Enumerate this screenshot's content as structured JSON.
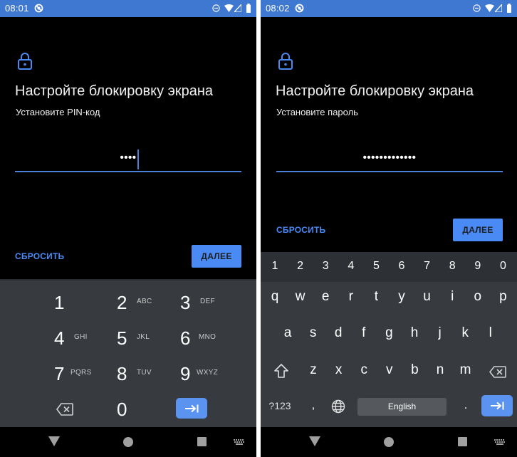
{
  "colors": {
    "statusbar": "#3f78d0",
    "accent": "#4a8af4",
    "keyboard_bg": "#373b3f",
    "numrow_bg": "#2d3135",
    "screen_bg": "#000000"
  },
  "screens": [
    {
      "status": {
        "time": "08:01",
        "icons": [
          "sync-off-icon",
          "do-not-disturb-icon",
          "wifi-icon",
          "cell-signal-icon",
          "battery-icon"
        ]
      },
      "icon": "lock-icon",
      "title": "Настройте блокировку экрана",
      "subtitle": "Установите PIN-код",
      "input": {
        "masked_value": "••••",
        "length": 4,
        "focused": true
      },
      "reset_label": "СБРОСИТЬ",
      "next_label": "ДАЛЕЕ",
      "keypad": {
        "keys": [
          {
            "digit": "1",
            "letters": ""
          },
          {
            "digit": "2",
            "letters": "ABC"
          },
          {
            "digit": "3",
            "letters": "DEF"
          },
          {
            "digit": "4",
            "letters": "GHI"
          },
          {
            "digit": "5",
            "letters": "JKL"
          },
          {
            "digit": "6",
            "letters": "MNO"
          },
          {
            "digit": "7",
            "letters": "PQRS"
          },
          {
            "digit": "8",
            "letters": "TUV"
          },
          {
            "digit": "9",
            "letters": "WXYZ"
          },
          {
            "digit": "0",
            "letters": ""
          }
        ],
        "backspace_icon": "backspace-icon",
        "enter_icon": "tab-next-icon"
      },
      "navbar": [
        "back-icon",
        "home-icon",
        "recents-icon",
        "keyboard-switch-icon"
      ]
    },
    {
      "status": {
        "time": "08:02",
        "icons": [
          "sync-off-icon",
          "do-not-disturb-icon",
          "wifi-icon",
          "cell-signal-icon",
          "battery-icon"
        ]
      },
      "icon": "lock-icon",
      "title": "Настройте блокировку экрана",
      "subtitle": "Установите пароль",
      "input": {
        "masked_value": "•••••••••••••",
        "length": 13,
        "focused": true
      },
      "reset_label": "СБРОСИТЬ",
      "next_label": "ДАЛЕЕ",
      "keyboard": {
        "number_row": [
          "1",
          "2",
          "3",
          "4",
          "5",
          "6",
          "7",
          "8",
          "9",
          "0"
        ],
        "row1": [
          "q",
          "w",
          "e",
          "r",
          "t",
          "y",
          "u",
          "i",
          "o",
          "p"
        ],
        "row2": [
          "a",
          "s",
          "d",
          "f",
          "g",
          "h",
          "j",
          "k",
          "l"
        ],
        "row3": [
          "z",
          "x",
          "c",
          "v",
          "b",
          "n",
          "m"
        ],
        "symbols_label": "?123",
        "comma": ",",
        "space_label": "English",
        "period": ".",
        "shift_icon": "shift-icon",
        "backspace_icon": "backspace-icon",
        "globe_icon": "globe-icon",
        "enter_icon": "tab-next-icon"
      },
      "navbar": [
        "back-icon",
        "home-icon",
        "recents-icon",
        "keyboard-switch-icon"
      ]
    }
  ]
}
